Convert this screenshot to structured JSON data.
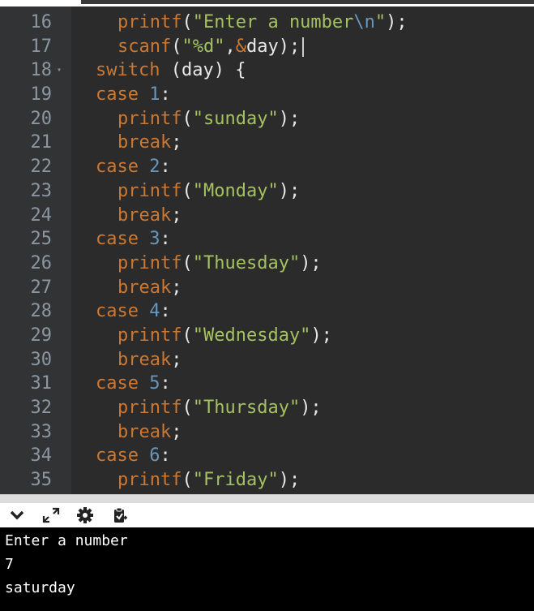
{
  "editor": {
    "lines": [
      {
        "n": "16",
        "indent": 2,
        "tokens": [
          {
            "t": "printf",
            "c": "fn"
          },
          {
            "t": "(",
            "c": "pl"
          },
          {
            "t": "\"Enter a number",
            "c": "str"
          },
          {
            "t": "\\n",
            "c": "esc"
          },
          {
            "t": "\"",
            "c": "str"
          },
          {
            "t": ");",
            "c": "pl"
          }
        ]
      },
      {
        "n": "17",
        "indent": 2,
        "cursor": true,
        "tokens": [
          {
            "t": "scanf",
            "c": "fn"
          },
          {
            "t": "(",
            "c": "pl"
          },
          {
            "t": "\"%d\"",
            "c": "str"
          },
          {
            "t": ",",
            "c": "pl"
          },
          {
            "t": "&",
            "c": "kw"
          },
          {
            "t": "day);",
            "c": "pl"
          }
        ]
      },
      {
        "n": "18",
        "indent": 1,
        "fold": true,
        "tokens": [
          {
            "t": "switch",
            "c": "sw"
          },
          {
            "t": " (day) {",
            "c": "pl"
          }
        ]
      },
      {
        "n": "19",
        "indent": 1,
        "tokens": [
          {
            "t": "case",
            "c": "kw"
          },
          {
            "t": " ",
            "c": "pl"
          },
          {
            "t": "1",
            "c": "num"
          },
          {
            "t": ":",
            "c": "pl"
          }
        ]
      },
      {
        "n": "20",
        "indent": 2,
        "tokens": [
          {
            "t": "printf",
            "c": "fn"
          },
          {
            "t": "(",
            "c": "pl"
          },
          {
            "t": "\"sunday\"",
            "c": "str"
          },
          {
            "t": ");",
            "c": "pl"
          }
        ]
      },
      {
        "n": "21",
        "indent": 2,
        "tokens": [
          {
            "t": "break",
            "c": "kw"
          },
          {
            "t": ";",
            "c": "pl"
          }
        ]
      },
      {
        "n": "22",
        "indent": 1,
        "tokens": [
          {
            "t": "case",
            "c": "kw"
          },
          {
            "t": " ",
            "c": "pl"
          },
          {
            "t": "2",
            "c": "num"
          },
          {
            "t": ":",
            "c": "pl"
          }
        ]
      },
      {
        "n": "23",
        "indent": 2,
        "tokens": [
          {
            "t": "printf",
            "c": "fn"
          },
          {
            "t": "(",
            "c": "pl"
          },
          {
            "t": "\"Monday\"",
            "c": "str"
          },
          {
            "t": ");",
            "c": "pl"
          }
        ]
      },
      {
        "n": "24",
        "indent": 2,
        "tokens": [
          {
            "t": "break",
            "c": "kw"
          },
          {
            "t": ";",
            "c": "pl"
          }
        ]
      },
      {
        "n": "25",
        "indent": 1,
        "tokens": [
          {
            "t": "case",
            "c": "kw"
          },
          {
            "t": " ",
            "c": "pl"
          },
          {
            "t": "3",
            "c": "num"
          },
          {
            "t": ":",
            "c": "pl"
          }
        ]
      },
      {
        "n": "26",
        "indent": 2,
        "tokens": [
          {
            "t": "printf",
            "c": "fn"
          },
          {
            "t": "(",
            "c": "pl"
          },
          {
            "t": "\"Thuesday\"",
            "c": "str"
          },
          {
            "t": ");",
            "c": "pl"
          }
        ]
      },
      {
        "n": "27",
        "indent": 2,
        "tokens": [
          {
            "t": "break",
            "c": "kw"
          },
          {
            "t": ";",
            "c": "pl"
          }
        ]
      },
      {
        "n": "28",
        "indent": 1,
        "tokens": [
          {
            "t": "case",
            "c": "kw"
          },
          {
            "t": " ",
            "c": "pl"
          },
          {
            "t": "4",
            "c": "num"
          },
          {
            "t": ":",
            "c": "pl"
          }
        ]
      },
      {
        "n": "29",
        "indent": 2,
        "tokens": [
          {
            "t": "printf",
            "c": "fn"
          },
          {
            "t": "(",
            "c": "pl"
          },
          {
            "t": "\"Wednesday\"",
            "c": "str"
          },
          {
            "t": ");",
            "c": "pl"
          }
        ]
      },
      {
        "n": "30",
        "indent": 2,
        "tokens": [
          {
            "t": "break",
            "c": "kw"
          },
          {
            "t": ";",
            "c": "pl"
          }
        ]
      },
      {
        "n": "31",
        "indent": 1,
        "tokens": [
          {
            "t": "case",
            "c": "kw"
          },
          {
            "t": " ",
            "c": "pl"
          },
          {
            "t": "5",
            "c": "num"
          },
          {
            "t": ":",
            "c": "pl"
          }
        ]
      },
      {
        "n": "32",
        "indent": 2,
        "tokens": [
          {
            "t": "printf",
            "c": "fn"
          },
          {
            "t": "(",
            "c": "pl"
          },
          {
            "t": "\"Thursday\"",
            "c": "str"
          },
          {
            "t": ");",
            "c": "pl"
          }
        ]
      },
      {
        "n": "33",
        "indent": 2,
        "tokens": [
          {
            "t": "break",
            "c": "kw"
          },
          {
            "t": ";",
            "c": "pl"
          }
        ]
      },
      {
        "n": "34",
        "indent": 1,
        "tokens": [
          {
            "t": "case",
            "c": "kw"
          },
          {
            "t": " ",
            "c": "pl"
          },
          {
            "t": "6",
            "c": "num"
          },
          {
            "t": ":",
            "c": "pl"
          }
        ]
      },
      {
        "n": "35",
        "indent": 2,
        "tokens": [
          {
            "t": "printf",
            "c": "fn"
          },
          {
            "t": "(",
            "c": "pl"
          },
          {
            "t": "\"Friday\"",
            "c": "str"
          },
          {
            "t": ");",
            "c": "pl"
          }
        ]
      }
    ]
  },
  "toolbar": {
    "icons": [
      "chevron-down-icon",
      "expand-icon",
      "gear-icon",
      "clipboard-icon"
    ]
  },
  "console": {
    "lines": [
      "Enter a number",
      "7",
      "saturday"
    ]
  },
  "colors": {
    "editor_bg": "#2b2b2b",
    "keyword": "#cc7832",
    "string": "#a5c261",
    "number": "#6897bb",
    "console_bg": "#000000"
  }
}
